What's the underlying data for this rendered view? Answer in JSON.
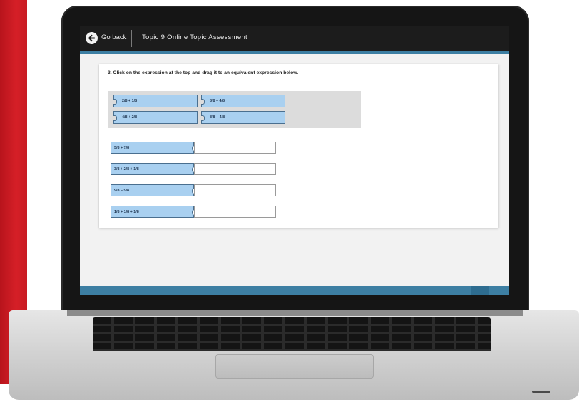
{
  "header": {
    "back_label": "Go back",
    "title": "Topic 9 Online Topic Assessment"
  },
  "question": {
    "prompt": "3. Click on the expression at the top and drag it to an equivalent expression below.",
    "source_tiles": [
      "2/8 + 1/8",
      "8/8 – 4/8",
      "4/8 + 2/8",
      "8/8 + 4/8"
    ],
    "targets": [
      {
        "expression": "5/8 + 7/8",
        "answer": ""
      },
      {
        "expression": "3/8 + 2/8 + 1/8",
        "answer": ""
      },
      {
        "expression": "9/8 – 5/8",
        "answer": ""
      },
      {
        "expression": "1/8 + 1/8 + 1/8",
        "answer": ""
      }
    ]
  },
  "colors": {
    "accent_blue": "#3d7fa3",
    "tile_blue": "#a9d0f0",
    "brand_red": "#d51f27"
  },
  "icons": {
    "back": "arrow-left-circle-icon"
  }
}
